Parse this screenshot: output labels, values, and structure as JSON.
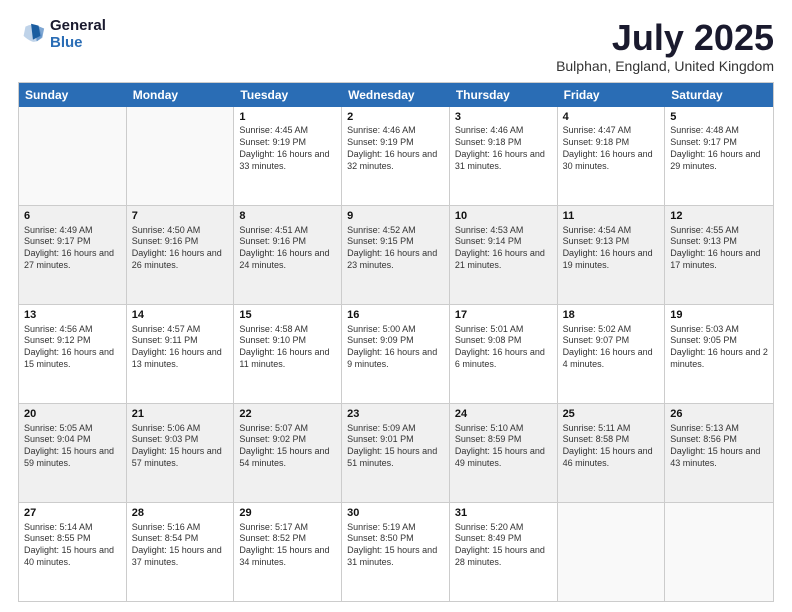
{
  "logo": {
    "general": "General",
    "blue": "Blue"
  },
  "title": "July 2025",
  "subtitle": "Bulphan, England, United Kingdom",
  "days": [
    "Sunday",
    "Monday",
    "Tuesday",
    "Wednesday",
    "Thursday",
    "Friday",
    "Saturday"
  ],
  "weeks": [
    [
      {
        "day": "",
        "sunrise": "",
        "sunset": "",
        "daylight": "",
        "empty": true
      },
      {
        "day": "",
        "sunrise": "",
        "sunset": "",
        "daylight": "",
        "empty": true
      },
      {
        "day": "1",
        "sunrise": "Sunrise: 4:45 AM",
        "sunset": "Sunset: 9:19 PM",
        "daylight": "Daylight: 16 hours and 33 minutes."
      },
      {
        "day": "2",
        "sunrise": "Sunrise: 4:46 AM",
        "sunset": "Sunset: 9:19 PM",
        "daylight": "Daylight: 16 hours and 32 minutes."
      },
      {
        "day": "3",
        "sunrise": "Sunrise: 4:46 AM",
        "sunset": "Sunset: 9:18 PM",
        "daylight": "Daylight: 16 hours and 31 minutes."
      },
      {
        "day": "4",
        "sunrise": "Sunrise: 4:47 AM",
        "sunset": "Sunset: 9:18 PM",
        "daylight": "Daylight: 16 hours and 30 minutes."
      },
      {
        "day": "5",
        "sunrise": "Sunrise: 4:48 AM",
        "sunset": "Sunset: 9:17 PM",
        "daylight": "Daylight: 16 hours and 29 minutes."
      }
    ],
    [
      {
        "day": "6",
        "sunrise": "Sunrise: 4:49 AM",
        "sunset": "Sunset: 9:17 PM",
        "daylight": "Daylight: 16 hours and 27 minutes."
      },
      {
        "day": "7",
        "sunrise": "Sunrise: 4:50 AM",
        "sunset": "Sunset: 9:16 PM",
        "daylight": "Daylight: 16 hours and 26 minutes."
      },
      {
        "day": "8",
        "sunrise": "Sunrise: 4:51 AM",
        "sunset": "Sunset: 9:16 PM",
        "daylight": "Daylight: 16 hours and 24 minutes."
      },
      {
        "day": "9",
        "sunrise": "Sunrise: 4:52 AM",
        "sunset": "Sunset: 9:15 PM",
        "daylight": "Daylight: 16 hours and 23 minutes."
      },
      {
        "day": "10",
        "sunrise": "Sunrise: 4:53 AM",
        "sunset": "Sunset: 9:14 PM",
        "daylight": "Daylight: 16 hours and 21 minutes."
      },
      {
        "day": "11",
        "sunrise": "Sunrise: 4:54 AM",
        "sunset": "Sunset: 9:13 PM",
        "daylight": "Daylight: 16 hours and 19 minutes."
      },
      {
        "day": "12",
        "sunrise": "Sunrise: 4:55 AM",
        "sunset": "Sunset: 9:13 PM",
        "daylight": "Daylight: 16 hours and 17 minutes."
      }
    ],
    [
      {
        "day": "13",
        "sunrise": "Sunrise: 4:56 AM",
        "sunset": "Sunset: 9:12 PM",
        "daylight": "Daylight: 16 hours and 15 minutes."
      },
      {
        "day": "14",
        "sunrise": "Sunrise: 4:57 AM",
        "sunset": "Sunset: 9:11 PM",
        "daylight": "Daylight: 16 hours and 13 minutes."
      },
      {
        "day": "15",
        "sunrise": "Sunrise: 4:58 AM",
        "sunset": "Sunset: 9:10 PM",
        "daylight": "Daylight: 16 hours and 11 minutes."
      },
      {
        "day": "16",
        "sunrise": "Sunrise: 5:00 AM",
        "sunset": "Sunset: 9:09 PM",
        "daylight": "Daylight: 16 hours and 9 minutes."
      },
      {
        "day": "17",
        "sunrise": "Sunrise: 5:01 AM",
        "sunset": "Sunset: 9:08 PM",
        "daylight": "Daylight: 16 hours and 6 minutes."
      },
      {
        "day": "18",
        "sunrise": "Sunrise: 5:02 AM",
        "sunset": "Sunset: 9:07 PM",
        "daylight": "Daylight: 16 hours and 4 minutes."
      },
      {
        "day": "19",
        "sunrise": "Sunrise: 5:03 AM",
        "sunset": "Sunset: 9:05 PM",
        "daylight": "Daylight: 16 hours and 2 minutes."
      }
    ],
    [
      {
        "day": "20",
        "sunrise": "Sunrise: 5:05 AM",
        "sunset": "Sunset: 9:04 PM",
        "daylight": "Daylight: 15 hours and 59 minutes."
      },
      {
        "day": "21",
        "sunrise": "Sunrise: 5:06 AM",
        "sunset": "Sunset: 9:03 PM",
        "daylight": "Daylight: 15 hours and 57 minutes."
      },
      {
        "day": "22",
        "sunrise": "Sunrise: 5:07 AM",
        "sunset": "Sunset: 9:02 PM",
        "daylight": "Daylight: 15 hours and 54 minutes."
      },
      {
        "day": "23",
        "sunrise": "Sunrise: 5:09 AM",
        "sunset": "Sunset: 9:01 PM",
        "daylight": "Daylight: 15 hours and 51 minutes."
      },
      {
        "day": "24",
        "sunrise": "Sunrise: 5:10 AM",
        "sunset": "Sunset: 8:59 PM",
        "daylight": "Daylight: 15 hours and 49 minutes."
      },
      {
        "day": "25",
        "sunrise": "Sunrise: 5:11 AM",
        "sunset": "Sunset: 8:58 PM",
        "daylight": "Daylight: 15 hours and 46 minutes."
      },
      {
        "day": "26",
        "sunrise": "Sunrise: 5:13 AM",
        "sunset": "Sunset: 8:56 PM",
        "daylight": "Daylight: 15 hours and 43 minutes."
      }
    ],
    [
      {
        "day": "27",
        "sunrise": "Sunrise: 5:14 AM",
        "sunset": "Sunset: 8:55 PM",
        "daylight": "Daylight: 15 hours and 40 minutes."
      },
      {
        "day": "28",
        "sunrise": "Sunrise: 5:16 AM",
        "sunset": "Sunset: 8:54 PM",
        "daylight": "Daylight: 15 hours and 37 minutes."
      },
      {
        "day": "29",
        "sunrise": "Sunrise: 5:17 AM",
        "sunset": "Sunset: 8:52 PM",
        "daylight": "Daylight: 15 hours and 34 minutes."
      },
      {
        "day": "30",
        "sunrise": "Sunrise: 5:19 AM",
        "sunset": "Sunset: 8:50 PM",
        "daylight": "Daylight: 15 hours and 31 minutes."
      },
      {
        "day": "31",
        "sunrise": "Sunrise: 5:20 AM",
        "sunset": "Sunset: 8:49 PM",
        "daylight": "Daylight: 15 hours and 28 minutes."
      },
      {
        "day": "",
        "sunrise": "",
        "sunset": "",
        "daylight": "",
        "empty": true
      },
      {
        "day": "",
        "sunrise": "",
        "sunset": "",
        "daylight": "",
        "empty": true
      }
    ]
  ]
}
